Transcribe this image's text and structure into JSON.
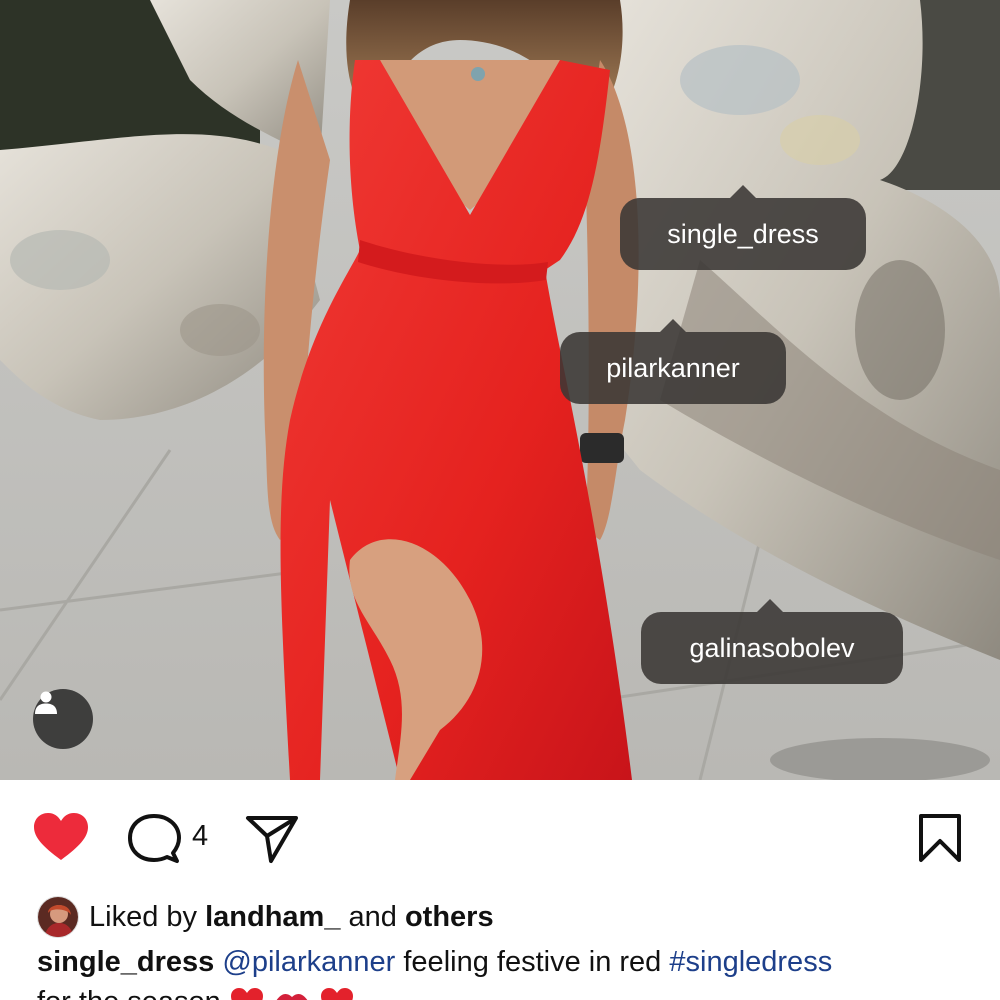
{
  "photo": {
    "tags": [
      {
        "username": "single_dress"
      },
      {
        "username": "pilarkanner"
      },
      {
        "username": "galinasobolev"
      }
    ],
    "user_tags_icon": "person-icon"
  },
  "actions": {
    "like_icon": "heart-filled-icon",
    "comment_icon": "comment-bubble-icon",
    "comment_count": "4",
    "share_icon": "paper-plane-icon",
    "save_icon": "bookmark-icon",
    "like_color": "#ed2b3b"
  },
  "likes": {
    "prefix": "Liked by",
    "user": "landham_",
    "conjunction": "and",
    "others": "others"
  },
  "caption": {
    "username": "single_dress",
    "mention": "@pilarkanner",
    "text": "feeling festive in red",
    "hashtag": "#singledress",
    "line2": "for the season",
    "emojis": [
      "red-heart-emoji",
      "kiss-mark-emoji",
      "red-heart-emoji"
    ]
  }
}
